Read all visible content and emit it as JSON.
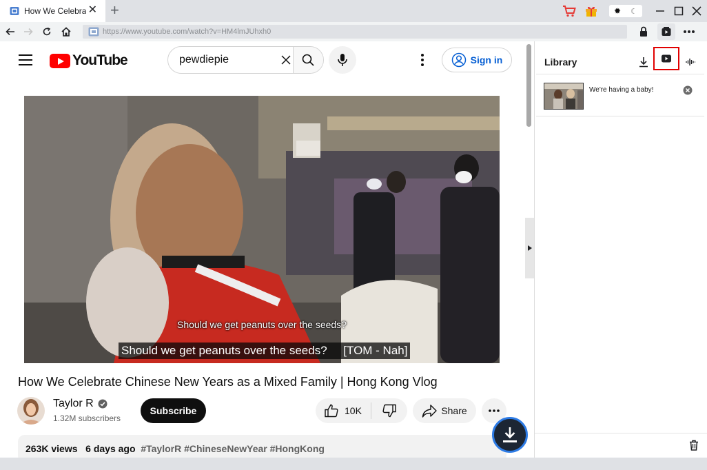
{
  "browser": {
    "tab_title": "How We Celebrat",
    "url": "https://www.youtube.com/watch?v=HM4lmJUhxh0"
  },
  "header": {
    "logo_text": "YouTube",
    "search_value": "pewdiepie",
    "signin_label": "Sign in"
  },
  "player": {
    "caption_line1": "Should we get peanuts over the seeds?",
    "caption_line2": "Should we get peanuts over the seeds?     [TOM - Nah]"
  },
  "video": {
    "title": "How We Celebrate Chinese New Years as a Mixed Family | Hong Kong Vlog",
    "channel_name": "Taylor R",
    "subscribers": "1.32M subscribers",
    "subscribe_label": "Subscribe",
    "likes": "10K",
    "share_label": "Share",
    "views": "263K views",
    "age": "6 days ago",
    "hashtags": "#TaylorR #ChineseNewYear #HongKong"
  },
  "library": {
    "title": "Library",
    "items": [
      {
        "title": "We're having a baby!"
      }
    ]
  },
  "colors": {
    "youtube_red": "#ff0000",
    "signin_blue": "#065fd4",
    "active_highlight": "#e10000",
    "fab_ring": "#2d7be5"
  }
}
